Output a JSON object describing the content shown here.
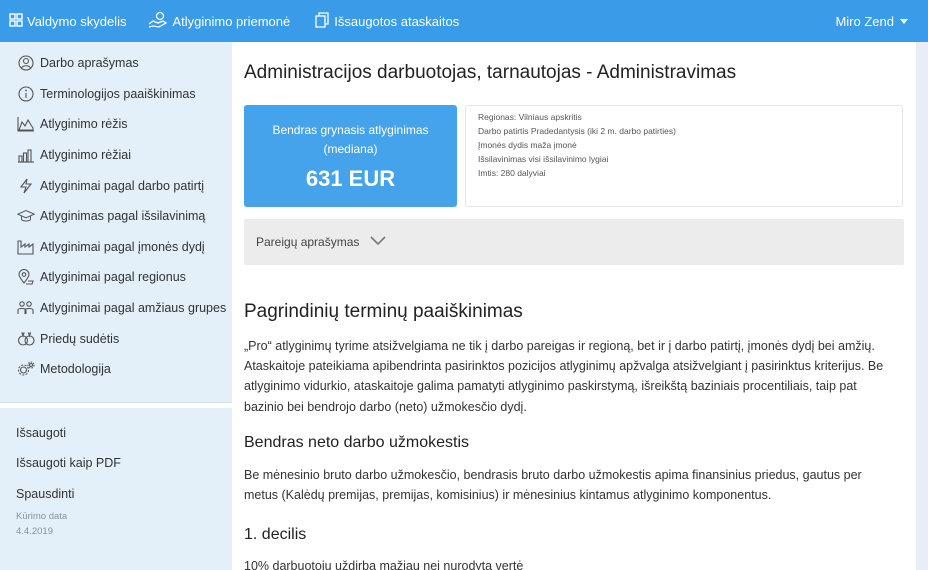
{
  "topbar": {
    "items": [
      {
        "label": "Valdymo skydelis",
        "icon": "dashboard-icon"
      },
      {
        "label": "Atlyginimo priemonė",
        "icon": "money-hand-icon"
      },
      {
        "label": "Išsaugotos ataskaitos",
        "icon": "copy-icon"
      }
    ],
    "user": "Miro Zend"
  },
  "sidebar": {
    "items": [
      {
        "label": "Darbo aprašymas",
        "icon": "user-circle-icon"
      },
      {
        "label": "Terminologijos paaiškinimas",
        "icon": "info-icon"
      },
      {
        "label": "Atlyginimo rėžis",
        "icon": "area-chart-icon"
      },
      {
        "label": "Atlyginimo rėžiai",
        "icon": "bar-chart-icon"
      },
      {
        "label": "Atlyginimai pagal darbo patirtį",
        "icon": "lightning-icon"
      },
      {
        "label": "Atlyginimas pagal išsilavinimą",
        "icon": "graduation-cap-icon"
      },
      {
        "label": "Atlyginimai pagal įmonės dydį",
        "icon": "factory-icon"
      },
      {
        "label": "Atlyginimai pagal regionus",
        "icon": "map-pin-icon"
      },
      {
        "label": "Atlyginimai pagal amžiaus grupes",
        "icon": "people-icon"
      },
      {
        "label": "Priedų sudėtis",
        "icon": "money-bag-icon"
      },
      {
        "label": "Metodologija",
        "icon": "gears-icon"
      }
    ],
    "actions": [
      {
        "label": "Išsaugoti"
      },
      {
        "label": "Išsaugoti kaip PDF"
      },
      {
        "label": "Spausdinti"
      }
    ],
    "created_label": "Kūrimo data",
    "created_date": "4.4.2019"
  },
  "main": {
    "title": "Administracijos darbuotojas, tarnautojas - Administravimas",
    "salary_label": "Bendras grynasis atlyginimas (mediana)",
    "salary_value": "631 EUR",
    "filters": [
      "Regionas: Vilniaus apskritis",
      "Darbo patirtis Pradedantysis (iki 2 m. darbo patirties)",
      "Įmonės dydis maža įmonė",
      "Išsilavinimas visi išsilavinimo lygiai",
      "Imtis: 280 dalyviai"
    ],
    "collapse_label": "Pareigų aprašymas",
    "section_title": "Pagrindinių terminų paaiškinimas",
    "intro_paragraph": "„Pro“ atlyginimų tyrime atsižvelgiama ne tik į darbo pareigas ir regioną, bet ir į darbo patirtį, įmonės dydį bei amžių. Ataskaitoje pateikiama apibendrinta pasirinktos pozicijos atlyginimų apžvalga atsižvelgiant į pasirinktus kriterijus. Be atlyginimo vidurkio, ataskaitoje galima pamatyti atlyginimo paskirstymą, išreikštą baziniais procentiliais, taip pat bazinio bei bendrojo darbo (neto) užmokesčio dydį.",
    "subsection_1": "Bendras neto darbo užmokestis",
    "paragraph_1": "Be mėnesinio bruto darbo užmokesčio, bendrasis bruto darbo užmokestis apima finansinius priedus, gautus per metus (Kalėdų premijas, premijas, komisinius) ir mėnesinius kintamus atlyginimo komponentus.",
    "subsection_2": "1. decilis",
    "paragraph_2": "10% darbuotojų uždirba mažiau nei nurodyta vertė"
  },
  "colors": {
    "topbar": "#3a9be8",
    "sidebar": "#e3eff9",
    "salary_card": "#45a3ec",
    "collapse_bar": "#ececec"
  }
}
